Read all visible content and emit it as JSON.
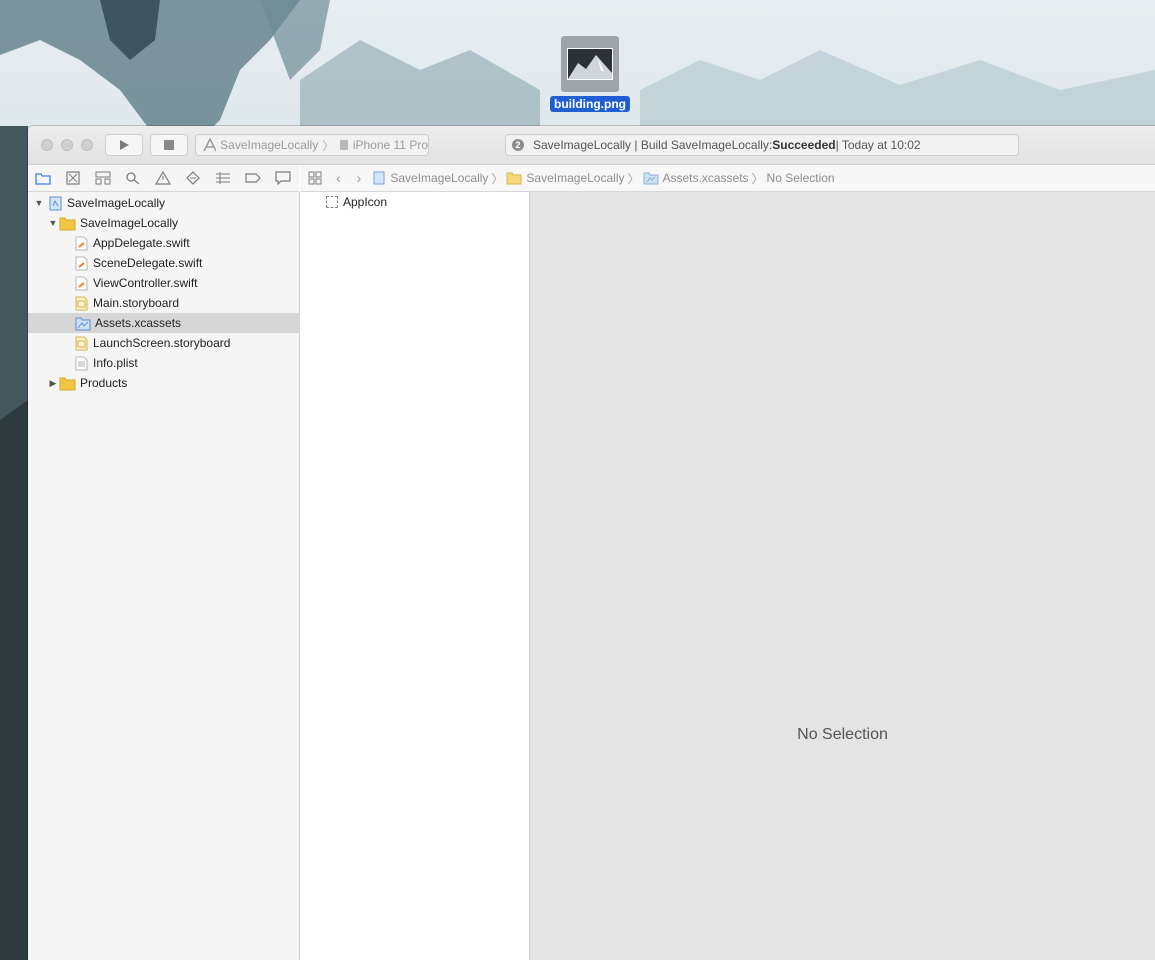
{
  "desktop": {
    "dragged_file": {
      "name": "building.png",
      "icon": "image-file-icon"
    }
  },
  "toolbar": {
    "run_icon": "play-icon",
    "stop_icon": "stop-icon",
    "scheme": {
      "name": "SaveImageLocally",
      "device": "iPhone 11 Pro"
    },
    "status": {
      "badge": "2",
      "prefix": "SaveImageLocally | Build SaveImageLocally: ",
      "result": "Succeeded",
      "suffix": " | Today at 10:02"
    }
  },
  "navigator_tabs": [
    {
      "icon": "folder-icon"
    },
    {
      "icon": "source-control-icon"
    },
    {
      "icon": "symbol-icon"
    },
    {
      "icon": "search-icon"
    },
    {
      "icon": "warning-icon"
    },
    {
      "icon": "test-icon"
    },
    {
      "icon": "debug-icon"
    },
    {
      "icon": "breakpoint-icon"
    },
    {
      "icon": "report-icon"
    }
  ],
  "jumpbar": {
    "items": [
      "SaveImageLocally",
      "SaveImageLocally",
      "Assets.xcassets",
      "No Selection"
    ]
  },
  "navigator": {
    "items": [
      {
        "label": "SaveImageLocally",
        "kind": "project",
        "expanded": true
      },
      {
        "label": "SaveImageLocally",
        "kind": "folder",
        "expanded": true
      },
      {
        "label": "AppDelegate.swift",
        "kind": "swift"
      },
      {
        "label": "SceneDelegate.swift",
        "kind": "swift"
      },
      {
        "label": "ViewController.swift",
        "kind": "swift"
      },
      {
        "label": "Main.storyboard",
        "kind": "storyboard"
      },
      {
        "label": "Assets.xcassets",
        "kind": "assets",
        "selected": true
      },
      {
        "label": "LaunchScreen.storyboard",
        "kind": "storyboard"
      },
      {
        "label": "Info.plist",
        "kind": "plist"
      },
      {
        "label": "Products",
        "kind": "folder",
        "expanded": false
      }
    ]
  },
  "assets": {
    "items": [
      "AppIcon"
    ]
  },
  "editor": {
    "empty_text": "No Selection"
  },
  "colors": {
    "selection": "#1f5fd1",
    "folder": "#f4c542",
    "accent_blue": "#5b8fd6"
  }
}
